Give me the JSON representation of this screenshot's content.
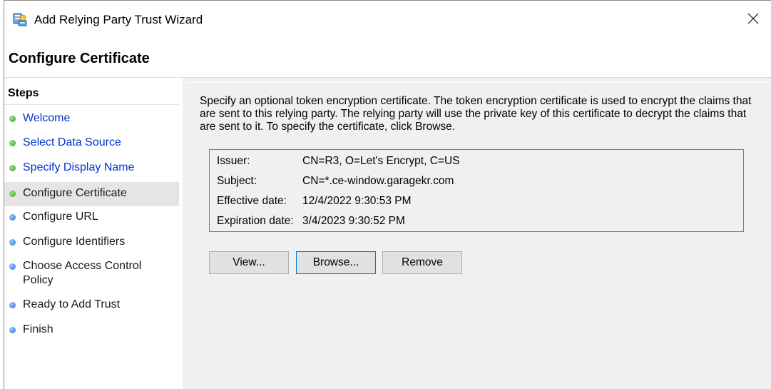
{
  "window": {
    "title": "Add Relying Party Trust Wizard",
    "icon": "relying-party-icon",
    "close_icon": "close-icon"
  },
  "header": {
    "title": "Configure Certificate"
  },
  "steps": {
    "heading": "Steps",
    "items": [
      {
        "label": "Welcome",
        "status": "completed",
        "link": true
      },
      {
        "label": "Select Data Source",
        "status": "completed",
        "link": true
      },
      {
        "label": "Specify Display Name",
        "status": "completed",
        "link": true
      },
      {
        "label": "Configure Certificate",
        "status": "current",
        "link": false
      },
      {
        "label": "Configure URL",
        "status": "pending",
        "link": false
      },
      {
        "label": "Configure Identifiers",
        "status": "pending",
        "link": false
      },
      {
        "label": "Choose Access Control Policy",
        "status": "pending",
        "link": false
      },
      {
        "label": "Ready to Add Trust",
        "status": "pending",
        "link": false
      },
      {
        "label": "Finish",
        "status": "pending",
        "link": false
      }
    ]
  },
  "content": {
    "description": "Specify an optional token encryption certificate.  The token encryption certificate is used to encrypt the claims that are sent to this relying party.  The relying party will use the private key of this certificate to decrypt the claims that are sent to it.  To specify the certificate, click Browse.",
    "certificate": {
      "issuer_label": "Issuer:",
      "issuer": "CN=R3, O=Let's Encrypt, C=US",
      "subject_label": "Subject:",
      "subject": "CN=*.ce-window.garagekr.com",
      "effective_label": "Effective date:",
      "effective": "12/4/2022 9:30:53 PM",
      "expiration_label": "Expiration date:",
      "expiration": "3/4/2023 9:30:52 PM"
    },
    "buttons": {
      "view": "View...",
      "browse": "Browse...",
      "remove": "Remove"
    }
  },
  "colors": {
    "link": "#0033cc",
    "completed_dot": "#3a9a2c",
    "pending_dot": "#2f6fd0",
    "content_bg": "#f0f0f0",
    "current_step_bg": "#e5e5e5",
    "focus_border": "#0078d7"
  }
}
